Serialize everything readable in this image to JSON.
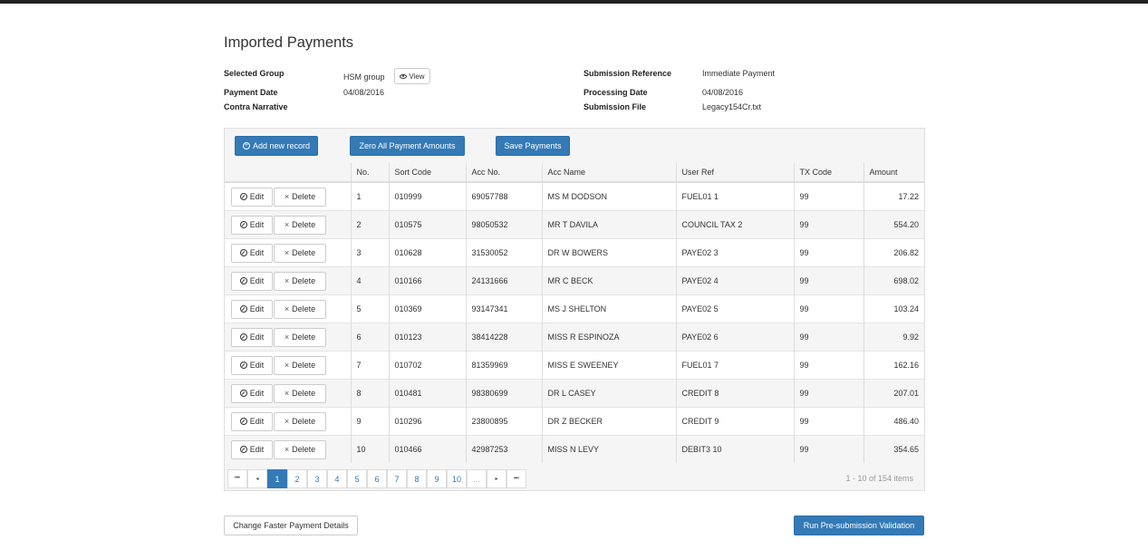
{
  "page": {
    "title": "Imported Payments"
  },
  "info": {
    "selected_group_label": "Selected Group",
    "selected_group_value": "HSM group",
    "view_label": "View",
    "payment_date_label": "Payment Date",
    "payment_date_value": "04/08/2016",
    "contra_narrative_label": "Contra Narrative",
    "contra_narrative_value": "",
    "submission_reference_label": "Submission Reference",
    "submission_reference_value": "Immediate Payment",
    "processing_date_label": "Processing Date",
    "processing_date_value": "04/08/2016",
    "submission_file_label": "Submission File",
    "submission_file_value": "Legacy154Cr.txt"
  },
  "toolbar": {
    "add_label": "Add new record",
    "zero_label": "Zero All Payment Amounts",
    "save_label": "Save Payments"
  },
  "grid": {
    "columns": [
      "",
      "No.",
      "Sort Code",
      "Acc No.",
      "Acc Name",
      "User Ref",
      "TX Code",
      "Amount"
    ],
    "edit_label": "Edit",
    "delete_label": "Delete",
    "rows": [
      {
        "no": "1",
        "sort": "010999",
        "acc": "69057788",
        "name": "MS M DODSON",
        "ref": "FUEL01 1",
        "tx": "99",
        "amount": "17.22"
      },
      {
        "no": "2",
        "sort": "010575",
        "acc": "98050532",
        "name": "MR T DAVILA",
        "ref": "COUNCIL TAX 2",
        "tx": "99",
        "amount": "554.20"
      },
      {
        "no": "3",
        "sort": "010628",
        "acc": "31530052",
        "name": "DR W BOWERS",
        "ref": "PAYE02 3",
        "tx": "99",
        "amount": "206.82"
      },
      {
        "no": "4",
        "sort": "010166",
        "acc": "24131666",
        "name": "MR C BECK",
        "ref": "PAYE02 4",
        "tx": "99",
        "amount": "698.02"
      },
      {
        "no": "5",
        "sort": "010369",
        "acc": "93147341",
        "name": "MS J SHELTON",
        "ref": "PAYE02 5",
        "tx": "99",
        "amount": "103.24"
      },
      {
        "no": "6",
        "sort": "010123",
        "acc": "38414228",
        "name": "MISS R ESPINOZA",
        "ref": "PAYE02 6",
        "tx": "99",
        "amount": "9.92"
      },
      {
        "no": "7",
        "sort": "010702",
        "acc": "81359969",
        "name": "MISS E SWEENEY",
        "ref": "FUEL01 7",
        "tx": "99",
        "amount": "162.16"
      },
      {
        "no": "8",
        "sort": "010481",
        "acc": "98380699",
        "name": "DR L CASEY",
        "ref": "CREDIT 8",
        "tx": "99",
        "amount": "207.01"
      },
      {
        "no": "9",
        "sort": "010296",
        "acc": "23800895",
        "name": "DR Z BECKER",
        "ref": "CREDIT 9",
        "tx": "99",
        "amount": "486.40"
      },
      {
        "no": "10",
        "sort": "010466",
        "acc": "42987253",
        "name": "MISS N LEVY",
        "ref": "DEBIT3 10",
        "tx": "99",
        "amount": "354.65"
      }
    ]
  },
  "pager": {
    "first": "⏮",
    "prev": "◂",
    "pages": [
      "1",
      "2",
      "3",
      "4",
      "5",
      "6",
      "7",
      "8",
      "9",
      "10",
      "..."
    ],
    "active_page": "1",
    "next": "▸",
    "last": "⏭",
    "info": "1 - 10 of 154 items"
  },
  "footer": {
    "change_label": "Change Faster Payment Details",
    "validate_label": "Run Pre-submission Validation"
  },
  "colors": {
    "primary": "#337ab7",
    "border": "#dddddd",
    "row_alt": "#f5f5f5"
  }
}
